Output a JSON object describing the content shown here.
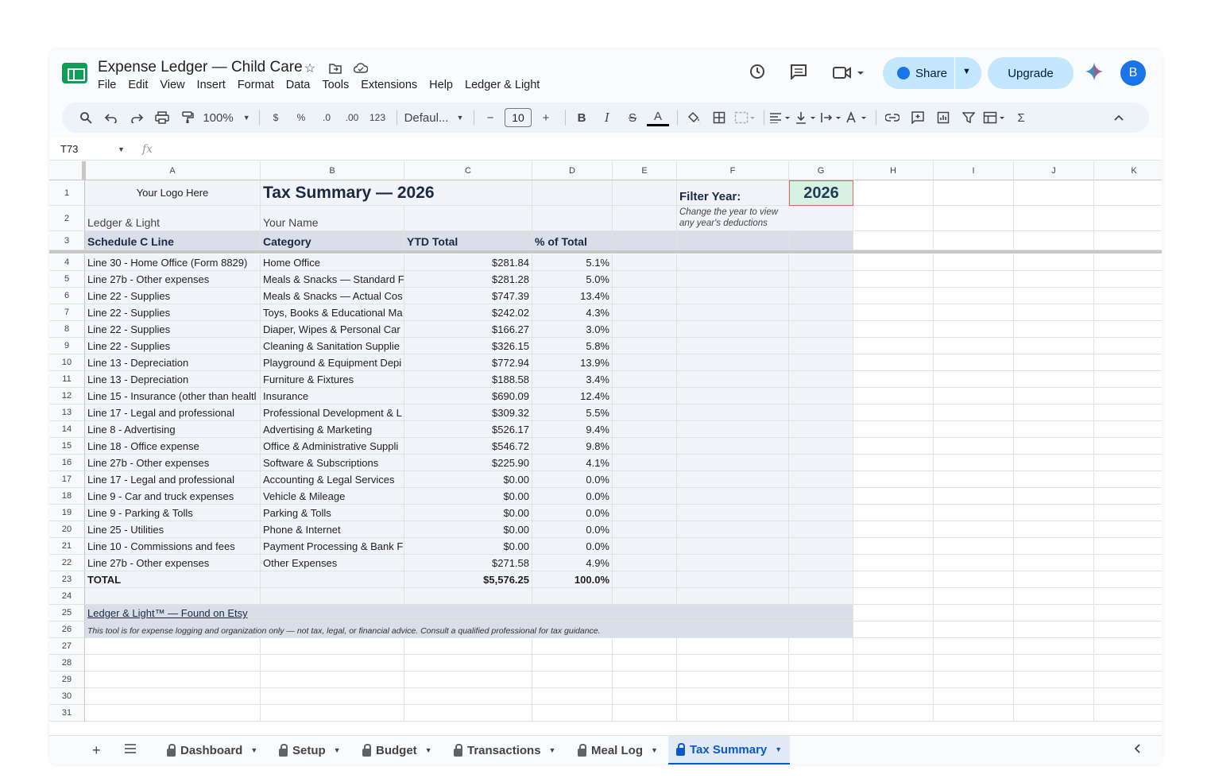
{
  "doc": {
    "title": "Expense Ledger — Child Care",
    "menu": [
      "File",
      "Edit",
      "View",
      "Insert",
      "Format",
      "Data",
      "Tools",
      "Extensions",
      "Help",
      "Ledger & Light"
    ]
  },
  "header": {
    "share_label": "Share",
    "upgrade_label": "Upgrade",
    "avatar_letter": "B"
  },
  "toolbar": {
    "zoom": "100%",
    "currency": "$",
    "percent": "%",
    "decrease_decimal": ".0",
    "increase_decimal": ".00",
    "number_format": "123",
    "font": "Defaul...",
    "font_size": "10",
    "bold": "B",
    "italic": "I",
    "strikethrough": "S",
    "text_color": "A",
    "function": "Σ"
  },
  "formula_bar": {
    "cell_ref": "T73",
    "fx": "fx"
  },
  "columns": [
    "A",
    "B",
    "C",
    "D",
    "E",
    "F",
    "G",
    "H",
    "I",
    "J",
    "K"
  ],
  "rows_numbers": [
    "1",
    "2",
    "3",
    "4",
    "5",
    "6",
    "7",
    "8",
    "9",
    "10",
    "11",
    "12",
    "13",
    "14",
    "15",
    "16",
    "17",
    "18",
    "19",
    "20",
    "21",
    "22",
    "23",
    "24",
    "25",
    "26",
    "27",
    "28",
    "29",
    "30",
    "31"
  ],
  "sheet": {
    "logo_text": "Your Logo Here",
    "title": "Tax Summary — 2026",
    "brand": "Ledger & Light",
    "your_name": "Your Name",
    "filter_label": "Filter Year:",
    "filter_year": "2026",
    "filter_hint_1": "Change the year to view",
    "filter_hint_2": "any year's deductions",
    "headers": [
      "Schedule C Line",
      "Category",
      "YTD Total",
      "% of Total"
    ],
    "rows": [
      [
        "Line 30 - Home Office (Form 8829)",
        "Home Office",
        "$281.84",
        "5.1%"
      ],
      [
        "Line 27b - Other expenses",
        "Meals & Snacks — Standard F",
        "$281.28",
        "5.0%"
      ],
      [
        "Line 22 - Supplies",
        "Meals & Snacks — Actual Cos",
        "$747.39",
        "13.4%"
      ],
      [
        "Line 22 - Supplies",
        "Toys, Books & Educational Ma",
        "$242.02",
        "4.3%"
      ],
      [
        "Line 22 - Supplies",
        "Diaper, Wipes & Personal Car",
        "$166.27",
        "3.0%"
      ],
      [
        "Line 22 - Supplies",
        "Cleaning & Sanitation Supplie",
        "$326.15",
        "5.8%"
      ],
      [
        "Line 13 - Depreciation",
        "Playground & Equipment Depi",
        "$772.94",
        "13.9%"
      ],
      [
        "Line 13 - Depreciation",
        "Furniture & Fixtures",
        "$188.58",
        "3.4%"
      ],
      [
        "Line 15 - Insurance (other than healtl",
        "Insurance",
        "$690.09",
        "12.4%"
      ],
      [
        "Line 17 - Legal and professional",
        "Professional Development & L",
        "$309.32",
        "5.5%"
      ],
      [
        "Line 8 - Advertising",
        "Advertising & Marketing",
        "$526.17",
        "9.4%"
      ],
      [
        "Line 18 - Office expense",
        "Office & Administrative Suppli",
        "$546.72",
        "9.8%"
      ],
      [
        "Line 27b - Other expenses",
        "Software & Subscriptions",
        "$225.90",
        "4.1%"
      ],
      [
        "Line 17 - Legal and professional",
        "Accounting & Legal Services",
        "$0.00",
        "0.0%"
      ],
      [
        "Line 9 - Car and truck expenses",
        "Vehicle & Mileage",
        "$0.00",
        "0.0%"
      ],
      [
        "Line 9 - Parking & Tolls",
        "Parking & Tolls",
        "$0.00",
        "0.0%"
      ],
      [
        "Line 25 - Utilities",
        "Phone & Internet",
        "$0.00",
        "0.0%"
      ],
      [
        "Line 10 - Commissions and fees",
        "Payment Processing & Bank F",
        "$0.00",
        "0.0%"
      ],
      [
        "Line 27b - Other expenses",
        "Other Expenses",
        "$271.58",
        "4.9%"
      ]
    ],
    "total": [
      "TOTAL",
      "",
      "$5,576.25",
      "100.0%"
    ],
    "footer_link": "Ledger & Light™  —  Found on Etsy",
    "disclaimer": "This tool is for expense logging and organization only — not tax, legal, or financial advice. Consult a qualified professional for tax guidance."
  },
  "tabs": [
    "Dashboard",
    "Setup",
    "Budget",
    "Transactions",
    "Meal Log",
    "Tax Summary"
  ],
  "active_tab": "Tax Summary"
}
